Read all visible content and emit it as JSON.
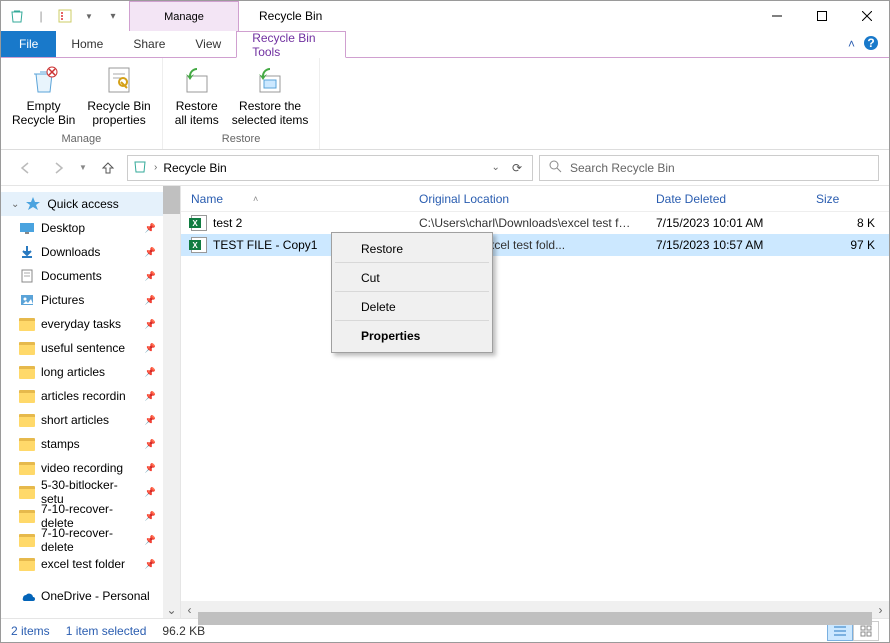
{
  "window": {
    "title": "Recycle Bin",
    "manage_label": "Manage"
  },
  "tabs": {
    "file": "File",
    "home": "Home",
    "share": "Share",
    "view": "View",
    "context": "Recycle Bin Tools"
  },
  "ribbon": {
    "groups": [
      {
        "label": "Manage",
        "items": [
          {
            "label": "Empty\nRecycle Bin"
          },
          {
            "label": "Recycle Bin\nproperties"
          }
        ]
      },
      {
        "label": "Restore",
        "items": [
          {
            "label": "Restore\nall items"
          },
          {
            "label": "Restore the\nselected items"
          }
        ]
      }
    ]
  },
  "address": {
    "location": "Recycle Bin"
  },
  "search": {
    "placeholder": "Search Recycle Bin"
  },
  "sidebar": {
    "section": "Quick access",
    "items": [
      {
        "label": "Desktop",
        "kind": "desktop"
      },
      {
        "label": "Downloads",
        "kind": "downloads"
      },
      {
        "label": "Documents",
        "kind": "documents"
      },
      {
        "label": "Pictures",
        "kind": "pictures"
      },
      {
        "label": "everyday tasks",
        "kind": "folder"
      },
      {
        "label": "useful sentence",
        "kind": "folder"
      },
      {
        "label": "long articles",
        "kind": "folder"
      },
      {
        "label": "articles recordin",
        "kind": "folder"
      },
      {
        "label": "short articles",
        "kind": "folder"
      },
      {
        "label": "stamps",
        "kind": "folder"
      },
      {
        "label": "video recording",
        "kind": "folder"
      },
      {
        "label": "5-30-bitlocker-setu",
        "kind": "folder"
      },
      {
        "label": "7-10-recover-delete",
        "kind": "folder"
      },
      {
        "label": "7-10-recover-delete",
        "kind": "folder"
      },
      {
        "label": "excel test folder",
        "kind": "folder"
      }
    ],
    "next_section": "OneDrive - Personal"
  },
  "columns": {
    "name": "Name",
    "origloc": "Original Location",
    "date": "Date Deleted",
    "size": "Size"
  },
  "files": [
    {
      "name": "test 2",
      "origloc": "C:\\Users\\charl\\Downloads\\excel test fold...",
      "date": "7/15/2023 10:01 AM",
      "size": "8 K",
      "selected": false
    },
    {
      "name": "TEST FILE - Copy1",
      "origloc": "Downloads\\excel test fold...",
      "date": "7/15/2023 10:57 AM",
      "size": "97 K",
      "selected": true
    }
  ],
  "context_menu": {
    "items": [
      "Restore",
      "Cut",
      "Delete",
      "Properties"
    ]
  },
  "status": {
    "count": "2 items",
    "selected": "1 item selected",
    "size": "96.2 KB"
  }
}
